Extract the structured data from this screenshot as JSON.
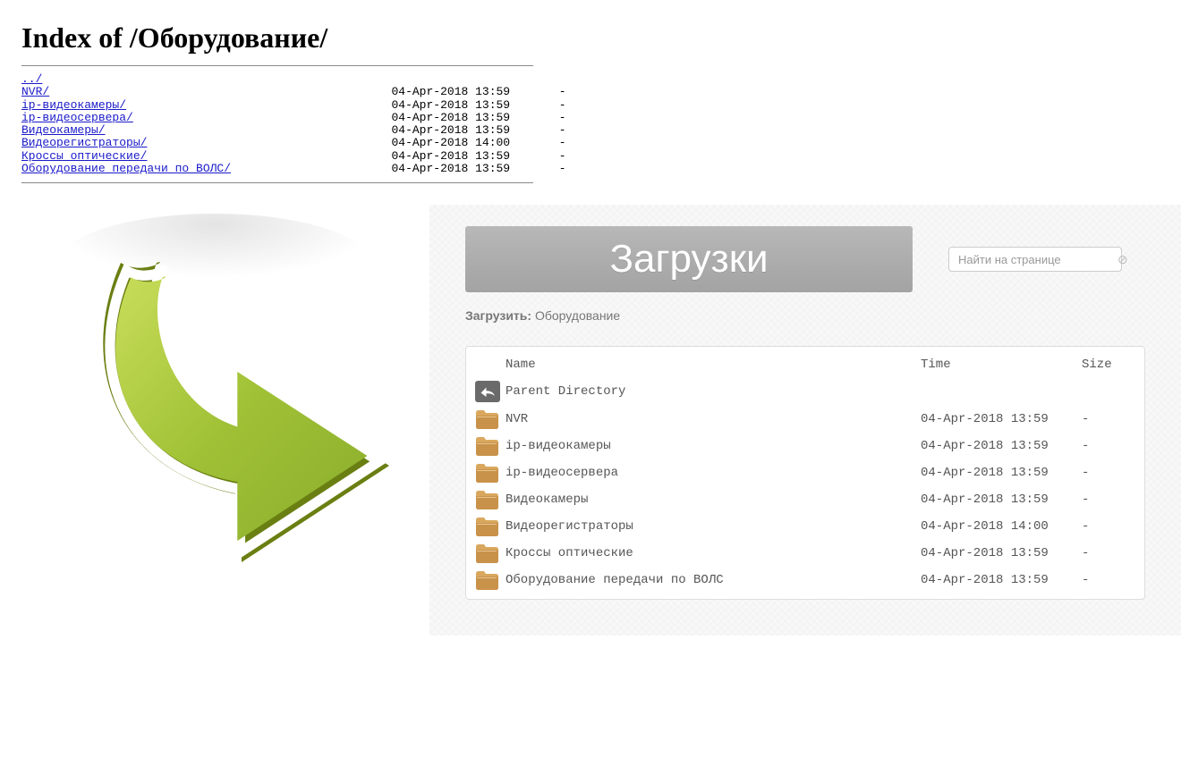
{
  "index": {
    "title": "Index of /Оборудование/",
    "entries": [
      {
        "name": "../",
        "time": "",
        "size": ""
      },
      {
        "name": "NVR/",
        "time": "04-Apr-2018 13:59",
        "size": "-"
      },
      {
        "name": "ip-видеокамеры/",
        "time": "04-Apr-2018 13:59",
        "size": "-"
      },
      {
        "name": "ip-видеосервера/",
        "time": "04-Apr-2018 13:59",
        "size": "-"
      },
      {
        "name": "Видеокамеры/",
        "time": "04-Apr-2018 13:59",
        "size": "-"
      },
      {
        "name": "Видеорегистраторы/",
        "time": "04-Apr-2018 14:00",
        "size": "-"
      },
      {
        "name": "Кроссы оптические/",
        "time": "04-Apr-2018 13:59",
        "size": "-"
      },
      {
        "name": "Оборудование передачи по ВОЛС/",
        "time": "04-Apr-2018 13:59",
        "size": "-"
      }
    ]
  },
  "styled": {
    "banner": "Загрузки",
    "search_placeholder": "Найти на странице",
    "breadcrumb_label": "Загрузить:",
    "breadcrumb_path": "Оборудование",
    "columns": {
      "name": "Name",
      "time": "Time",
      "size": "Size"
    },
    "parent": "Parent Directory",
    "rows": [
      {
        "name": "NVR",
        "time": "04-Apr-2018 13:59",
        "size": "-"
      },
      {
        "name": "ip-видеокамеры",
        "time": "04-Apr-2018 13:59",
        "size": "-"
      },
      {
        "name": "ip-видеосервера",
        "time": "04-Apr-2018 13:59",
        "size": "-"
      },
      {
        "name": "Видеокамеры",
        "time": "04-Apr-2018 13:59",
        "size": "-"
      },
      {
        "name": "Видеорегистраторы",
        "time": "04-Apr-2018 14:00",
        "size": "-"
      },
      {
        "name": "Кроссы оптические",
        "time": "04-Apr-2018 13:59",
        "size": "-"
      },
      {
        "name": "Оборудование передачи по ВОЛС",
        "time": "04-Apr-2018 13:59",
        "size": "-"
      }
    ]
  }
}
